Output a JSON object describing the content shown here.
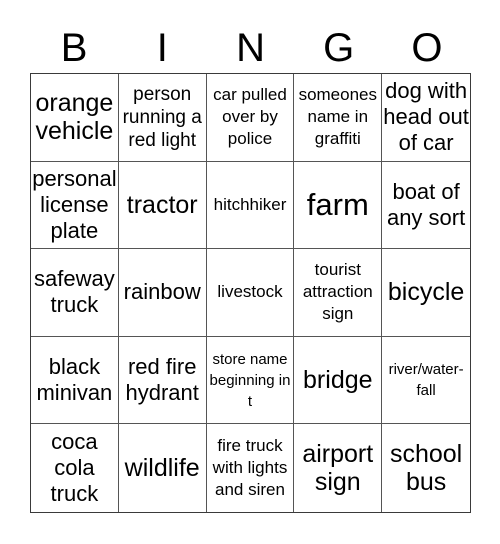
{
  "header": {
    "letters": [
      "B",
      "I",
      "N",
      "G",
      "O"
    ]
  },
  "cells": [
    {
      "text": "orange vehicle",
      "size": "s-l"
    },
    {
      "text": "person running a red light",
      "size": "s-m"
    },
    {
      "text": "car pulled over by police",
      "size": "s-s"
    },
    {
      "text": "someones name in graffiti",
      "size": "s-s"
    },
    {
      "text": "dog with head out of car",
      "size": "s-ml"
    },
    {
      "text": "personal license plate",
      "size": "s-ml"
    },
    {
      "text": "tractor",
      "size": "s-l"
    },
    {
      "text": "hitchhiker",
      "size": "s-s"
    },
    {
      "text": "farm",
      "size": "s-xl"
    },
    {
      "text": "boat of any sort",
      "size": "s-ml"
    },
    {
      "text": "safeway truck",
      "size": "s-ml"
    },
    {
      "text": "rainbow",
      "size": "s-ml"
    },
    {
      "text": "livestock",
      "size": "s-s"
    },
    {
      "text": "tourist attraction sign",
      "size": "s-s"
    },
    {
      "text": "bicycle",
      "size": "s-l"
    },
    {
      "text": "black minivan",
      "size": "s-ml"
    },
    {
      "text": "red fire hydrant",
      "size": "s-ml"
    },
    {
      "text": "store name beginning in t",
      "size": "s-xs"
    },
    {
      "text": "bridge",
      "size": "s-l"
    },
    {
      "text": "river/water-fall",
      "size": "s-xs"
    },
    {
      "text": "coca cola truck",
      "size": "s-ml"
    },
    {
      "text": "wildlife",
      "size": "s-l"
    },
    {
      "text": "fire truck with lights and siren",
      "size": "s-s"
    },
    {
      "text": "airport sign",
      "size": "s-l"
    },
    {
      "text": "school bus",
      "size": "s-l"
    }
  ]
}
